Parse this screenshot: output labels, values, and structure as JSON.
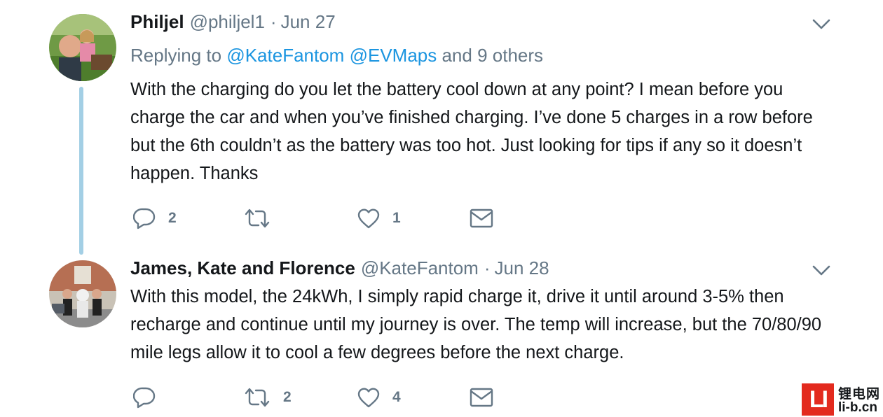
{
  "tweets": [
    {
      "name": "Philjel",
      "handle": "@philjel1",
      "separator": "·",
      "date": "Jun 27",
      "replying_prefix": "Replying to",
      "replying_mentions": [
        "@KateFantom",
        "@EVMaps"
      ],
      "replying_suffix": "and 9 others",
      "text": "With the charging do you let the battery cool down at any point? I mean before you charge the car and when you’ve finished charging. I’ve done 5 charges in a row before but the 6th couldn’t as the battery was too hot. Just looking for tips if any so it doesn’t happen. Thanks",
      "reply_count": "2",
      "retweet_count": "",
      "like_count": "1"
    },
    {
      "name": "James, Kate and Florence",
      "handle": "@KateFantom",
      "separator": "·",
      "date": "Jun 28",
      "text": "With this model, the 24kWh, I simply rapid charge it, drive it until around 3-5% then recharge and continue until my journey is over. The temp will increase, but the 70/80/90 mile legs allow it to cool a few degrees before the next charge.",
      "reply_count": "",
      "retweet_count": "2",
      "like_count": "4"
    }
  ],
  "icons": {
    "reply": "reply-icon",
    "retweet": "retweet-icon",
    "like": "like-icon",
    "message": "message-icon",
    "caret": "chevron-down-icon"
  },
  "colors": {
    "name": "#14171a",
    "secondary": "#657786",
    "mention": "#1b95e0",
    "thread_line": "#a3cfe5",
    "watermark_red": "#e32a1e"
  },
  "watermark": {
    "logo": "LI",
    "cn": "锂电网",
    "url": "li-b.cn"
  }
}
